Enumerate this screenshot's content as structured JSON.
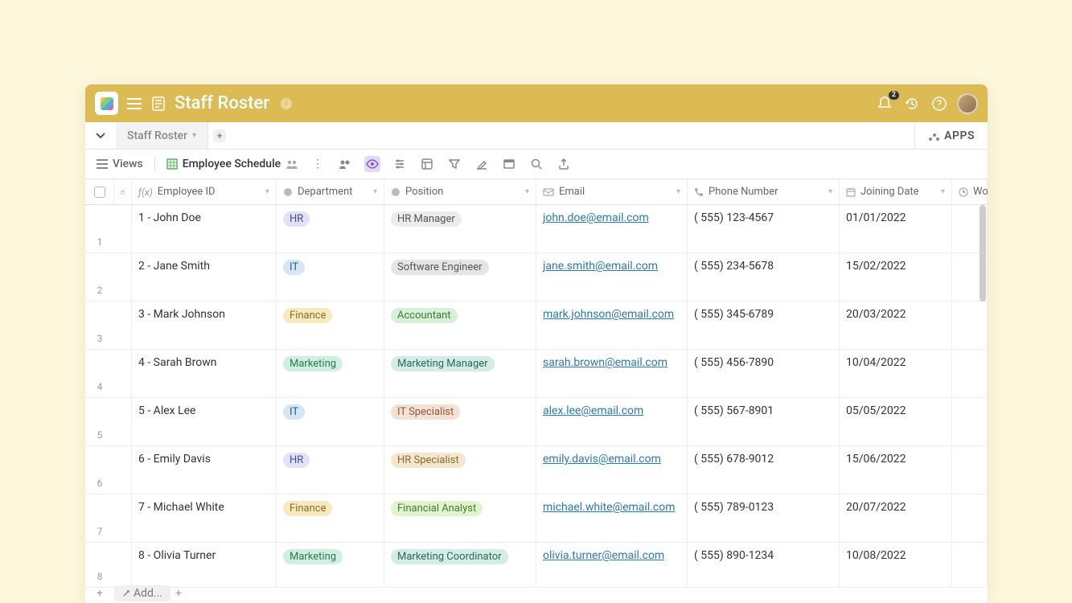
{
  "topbar": {
    "title": "Staff Roster",
    "notification_count": "2"
  },
  "tabs": {
    "active_tab": "Staff Roster",
    "apps_label": "APPS"
  },
  "toolbar": {
    "views_label": "Views",
    "sheet_name": "Employee Schedule"
  },
  "columns": {
    "employee_id": "Employee ID",
    "department": "Department",
    "position": "Position",
    "email": "Email",
    "phone": "Phone Number",
    "joining_date": "Joining Date",
    "last_partial": "Wo"
  },
  "pill_colors": {
    "HR": {
      "bg": "#e3e1f7",
      "fg": "#4a4a8a"
    },
    "IT": {
      "bg": "#d6e6f5",
      "fg": "#2a5a8a"
    },
    "Finance": {
      "bg": "#f7eac0",
      "fg": "#8a6d1a"
    },
    "Marketing": {
      "bg": "#d0efe0",
      "fg": "#2a7a55"
    },
    "HR Manager": {
      "bg": "#ececec",
      "fg": "#555"
    },
    "Software Engineer": {
      "bg": "#e5e5e5",
      "fg": "#555"
    },
    "Accountant": {
      "bg": "#d7f0d7",
      "fg": "#3a7a3a"
    },
    "Marketing Manager": {
      "bg": "#d4ece5",
      "fg": "#2a6a55"
    },
    "IT Specialist": {
      "bg": "#f5e0d4",
      "fg": "#8a5a3a"
    },
    "HR Specialist": {
      "bg": "#f5e6d0",
      "fg": "#8a6a2a"
    },
    "Financial Analyst": {
      "bg": "#def5d0",
      "fg": "#4a7a2a"
    },
    "Marketing Coordinator": {
      "bg": "#d4ece5",
      "fg": "#2a6a55"
    }
  },
  "rows": [
    {
      "n": "1",
      "emp": "1 - John Doe",
      "dept": "HR",
      "pos": "HR Manager",
      "email": "john.doe@email.com",
      "phone": "( 555) 123-4567",
      "date": "01/01/2022"
    },
    {
      "n": "2",
      "emp": "2 - Jane Smith",
      "dept": "IT",
      "pos": "Software Engineer",
      "email": "jane.smith@email.com",
      "phone": "( 555) 234-5678",
      "date": "15/02/2022"
    },
    {
      "n": "3",
      "emp": "3 - Mark Johnson",
      "dept": "Finance",
      "pos": "Accountant",
      "email": "mark.johnson@email.com",
      "phone": "( 555) 345-6789",
      "date": "20/03/2022"
    },
    {
      "n": "4",
      "emp": "4 - Sarah Brown",
      "dept": "Marketing",
      "pos": "Marketing Manager",
      "email": "sarah.brown@email.com",
      "phone": "( 555) 456-7890",
      "date": "10/04/2022"
    },
    {
      "n": "5",
      "emp": "5 - Alex Lee",
      "dept": "IT",
      "pos": "IT Specialist",
      "email": "alex.lee@email.com",
      "phone": "( 555) 567-8901",
      "date": "05/05/2022"
    },
    {
      "n": "6",
      "emp": "6 - Emily Davis",
      "dept": "HR",
      "pos": "HR Specialist",
      "email": "emily.davis@email.com",
      "phone": "( 555) 678-9012",
      "date": "15/06/2022"
    },
    {
      "n": "7",
      "emp": "7 - Michael White",
      "dept": "Finance",
      "pos": "Financial Analyst",
      "email": "michael.white@email.com",
      "phone": "( 555) 789-0123",
      "date": "20/07/2022"
    },
    {
      "n": "8",
      "emp": "8 - Olivia Turner",
      "dept": "Marketing",
      "pos": "Marketing Coordinator",
      "email": "olivia.turner@email.com",
      "phone": "( 555) 890-1234",
      "date": "10/08/2022"
    }
  ],
  "footer": {
    "add_label": "Add..."
  }
}
